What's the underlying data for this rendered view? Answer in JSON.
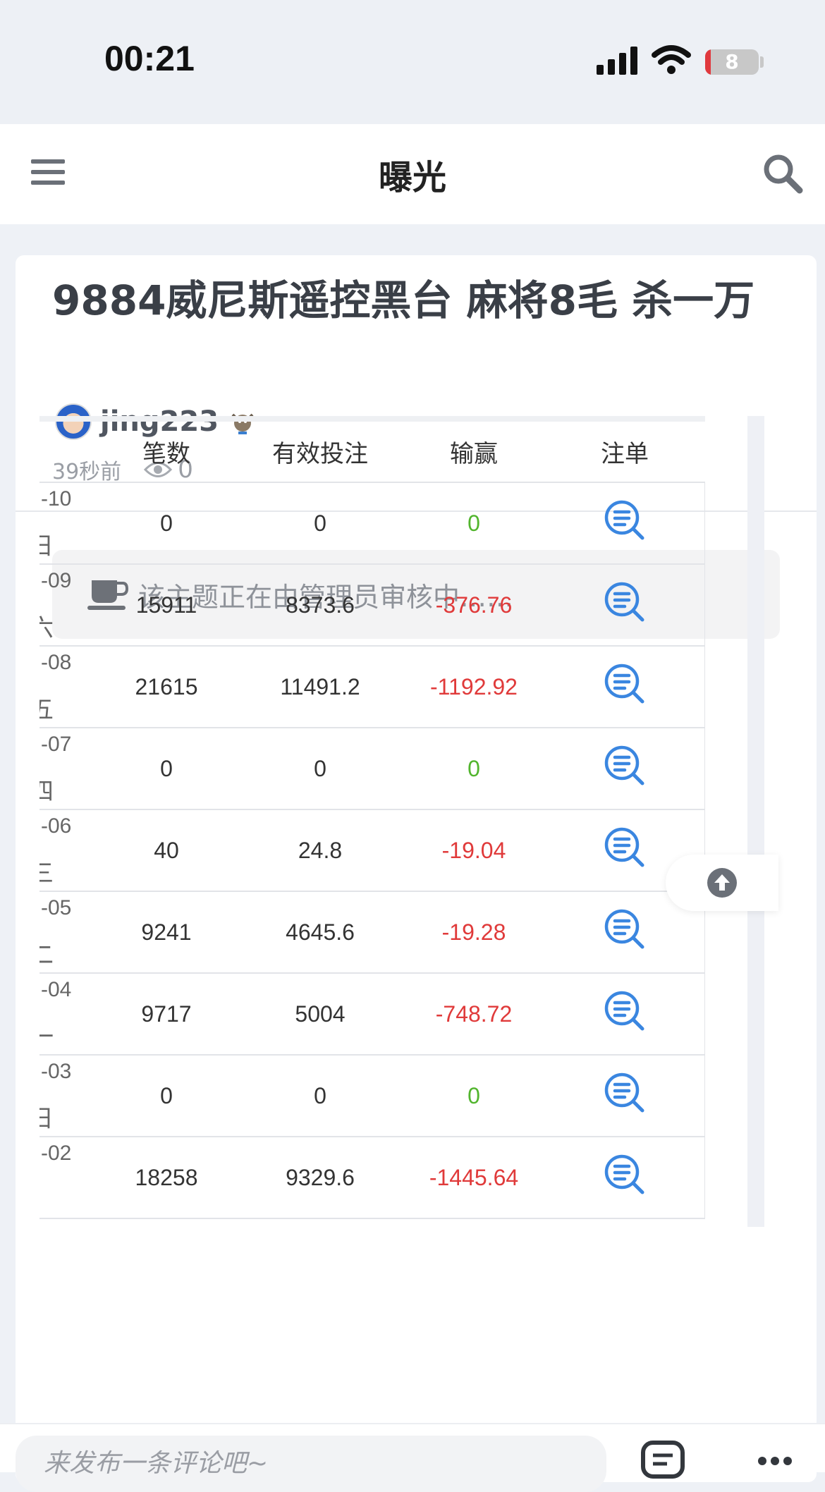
{
  "status_bar": {
    "time": "00:21",
    "battery": "8"
  },
  "navbar": {
    "title": "曝光",
    "menu_icon": "hamburger-menu-icon",
    "search_icon": "search-icon"
  },
  "post": {
    "title": "9884威尼斯遥控黑台 麻将8毛 杀一万",
    "author": "jing223",
    "time_ago": "39秒前",
    "views": "0",
    "notice": "该主题正在由管理员审核中……"
  },
  "table": {
    "headers": [
      "",
      "笔数",
      "有效投注",
      "输赢",
      "注单"
    ],
    "rows": [
      {
        "date": "-10",
        "weekday": "日",
        "count": "0",
        "bet": "0",
        "win": "0",
        "neg": false
      },
      {
        "date": "-09",
        "weekday": "六",
        "count": "15911",
        "bet": "8373.6",
        "win": "-376.76",
        "neg": true
      },
      {
        "date": "-08",
        "weekday": "五",
        "count": "21615",
        "bet": "11491.2",
        "win": "-1192.92",
        "neg": true
      },
      {
        "date": "-07",
        "weekday": "四",
        "count": "0",
        "bet": "0",
        "win": "0",
        "neg": false
      },
      {
        "date": "-06",
        "weekday": "三",
        "count": "40",
        "bet": "24.8",
        "win": "-19.04",
        "neg": true
      },
      {
        "date": "-05",
        "weekday": "二",
        "count": "9241",
        "bet": "4645.6",
        "win": "-19.28",
        "neg": true
      },
      {
        "date": "-04",
        "weekday": "一",
        "count": "9717",
        "bet": "5004",
        "win": "-748.72",
        "neg": true
      },
      {
        "date": "-03",
        "weekday": "日",
        "count": "0",
        "bet": "0",
        "win": "0",
        "neg": false
      },
      {
        "date": "-02",
        "weekday": "",
        "count": "18258",
        "bet": "9329.6",
        "win": "-1445.64",
        "neg": true
      }
    ]
  },
  "comment": {
    "placeholder": "来发布一条评论吧~"
  },
  "colors": {
    "positive_zero": "#52b52e",
    "negative": "#e03a3a",
    "icon_blue": "#3a86e0"
  }
}
